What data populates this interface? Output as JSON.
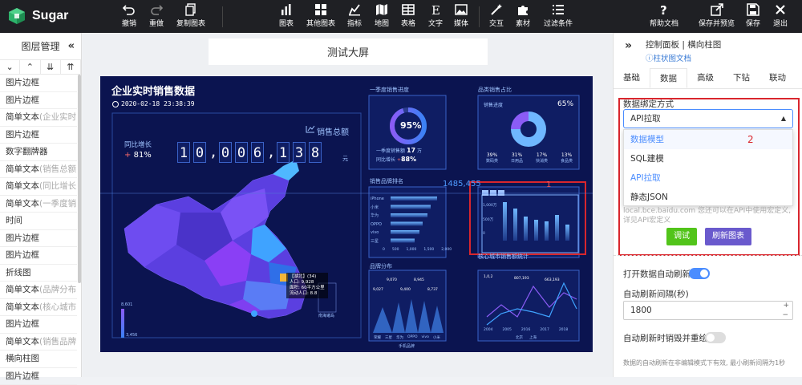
{
  "app": {
    "name": "Sugar"
  },
  "toolbar": {
    "undo": "撤销",
    "redo": "重做",
    "copy_chart": "复制图表",
    "chart": "图表",
    "other_chart": "其他图表",
    "indicator": "指标",
    "map": "地图",
    "table": "表格",
    "text": "文字",
    "media": "媒体",
    "interaction": "交互",
    "material": "素材",
    "filter": "过滤条件",
    "help": "帮助文档",
    "save_preview": "保存并预览",
    "save": "保存",
    "exit": "退出"
  },
  "left": {
    "title": "图层管理",
    "items": [
      {
        "label": "图片边框",
        "sub": ""
      },
      {
        "label": "图片边框",
        "sub": ""
      },
      {
        "label": "简单文本",
        "sub": "(企业实时…"
      },
      {
        "label": "图片边框",
        "sub": ""
      },
      {
        "label": "数字翻牌器",
        "sub": ""
      },
      {
        "label": "简单文本",
        "sub": "(销售总额)"
      },
      {
        "label": "简单文本",
        "sub": "(同比增长)"
      },
      {
        "label": "简单文本",
        "sub": "(一季度销…"
      },
      {
        "label": "时间",
        "sub": ""
      },
      {
        "label": "图片边框",
        "sub": ""
      },
      {
        "label": "图片边框",
        "sub": ""
      },
      {
        "label": "折线图",
        "sub": ""
      },
      {
        "label": "简单文本",
        "sub": "(品牌分布)"
      },
      {
        "label": "简单文本",
        "sub": "(核心城市…"
      },
      {
        "label": "图片边框",
        "sub": ""
      },
      {
        "label": "简单文本",
        "sub": "(销售品牌…"
      },
      {
        "label": "横向柱图",
        "sub": ""
      },
      {
        "label": "图片边框",
        "sub": ""
      }
    ]
  },
  "canvas": {
    "page_title": "测试大屏"
  },
  "screen": {
    "title": "企业实时销售数据",
    "datetime": "2020-02-18 23:38:39",
    "total_label": "销售总额",
    "yoy_label": "同比增长",
    "yoy_value": "81%",
    "digits": [
      "1",
      "0",
      ",",
      "0",
      "0",
      "6",
      ",",
      "1",
      "3",
      "8"
    ],
    "unit": "元",
    "p1_title": "一季度销售进度",
    "p1_value": "95%",
    "p1_sales_label": "一季度销售额",
    "p1_sales_value": "17",
    "p1_sales_unit": "万",
    "p1_yoy_label": "同比增长",
    "p1_yoy_value": "88%",
    "p2_title": "品类销售占比",
    "p2_sub": "销售进度",
    "p2_value": "65%",
    "p2_stats": [
      {
        "v": "39%",
        "l": "数码类"
      },
      {
        "v": "31%",
        "l": "日用品"
      },
      {
        "v": "17%",
        "l": "快消类"
      },
      {
        "v": "13%",
        "l": "食品类"
      }
    ],
    "p3_title": "销售品牌排名",
    "p3_float": "1485,455",
    "p3_brands": [
      "iPhone",
      "小米",
      "华为",
      "OPPO",
      "vivo",
      "三星"
    ],
    "p3_axis": [
      "0",
      "500",
      "1,000",
      "1,500",
      "2,000"
    ],
    "p4_title": "",
    "p4_axis": [
      "1,000万",
      "500万",
      "0"
    ],
    "p5_title": "品牌分布",
    "p5_labels": [
      "9,027",
      "9,070",
      "9,400",
      "8,945",
      "8,737"
    ],
    "p5_x": [
      "荣耀",
      "三星",
      "华为",
      "OPPO",
      "vivo",
      "小米"
    ],
    "p5_legend": "手机品牌",
    "p6_title": "核心城市销售额统计",
    "p6_labels": [
      "1,0,2",
      "807,193",
      "663,193"
    ],
    "p6_x": [
      "2004",
      "2005",
      "2016",
      "2017",
      "2018"
    ],
    "p6_legend": [
      "北京",
      "上海"
    ],
    "map_tooltip": [
      "【湖北】(34)",
      "人口: 9,928",
      "面积: 60平方公里",
      "流动人口: 8.8"
    ],
    "map_scale_max": "8,601",
    "map_scale_min": "3,456",
    "map_sea": "南海诸岛",
    "marker_1": "1"
  },
  "annot": {
    "marker_2": "2"
  },
  "right": {
    "title": "控制面板 | 横向柱图",
    "link": "柱状图文档",
    "tabs": [
      "基础",
      "数据",
      "高级",
      "下钻",
      "联动"
    ],
    "active_tab": 1,
    "bind_label": "数据绑定方式",
    "bind_value": "API拉取",
    "options": [
      "数据模型",
      "SQL建模",
      "API拉取",
      "静态JSON"
    ],
    "hint": "local.bce.baidu.com 您还可以在API中使用宏定义, 详见API宏定义",
    "debug": "调试",
    "refresh_chart": "刷新图表",
    "auto_refresh": "打开数据自动刷新",
    "interval_label": "自动刷新间隔(秒)",
    "interval_value": "1800",
    "destroy_label": "自动刷新时销毁并重绘",
    "footnote": "数据的自动刷新在非编辑模式下有效, 最小刷新间隔为1秒"
  },
  "colors": {
    "topbar": "#1f2024",
    "screen_bg": "#0b1450",
    "accent": "#4b8dff",
    "green": "#52c41a",
    "purple": "#6a5acd",
    "red": "#d9262d"
  }
}
